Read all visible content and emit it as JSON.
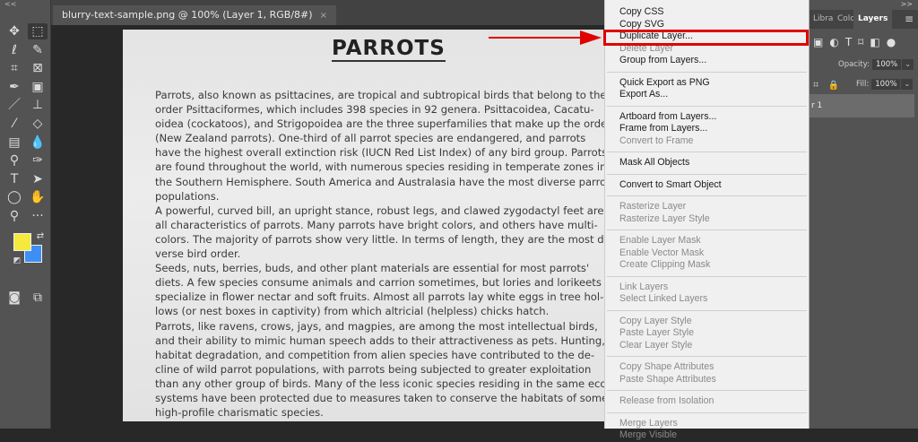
{
  "document_tab": {
    "title": "blurry-text-sample.png @ 100% (Layer 1, RGB/8#)",
    "close": "×"
  },
  "toolbar": {
    "collapse": "<<",
    "tools": [
      {
        "name": "move-tool",
        "glyph": "✥"
      },
      {
        "name": "marquee-tool",
        "glyph": "⬚"
      },
      {
        "name": "lasso-tool",
        "glyph": "ℓ"
      },
      {
        "name": "quick-selection-tool",
        "glyph": "✎"
      },
      {
        "name": "crop-tool",
        "glyph": "⌗"
      },
      {
        "name": "frame-tool",
        "glyph": "⊠"
      },
      {
        "name": "eyedropper-tool",
        "glyph": "✒"
      },
      {
        "name": "healing-tool",
        "glyph": "▣"
      },
      {
        "name": "brush-tool",
        "glyph": "／"
      },
      {
        "name": "stamp-tool",
        "glyph": "⊥"
      },
      {
        "name": "history-brush-tool",
        "glyph": "⁄"
      },
      {
        "name": "eraser-tool",
        "glyph": "◇"
      },
      {
        "name": "gradient-tool",
        "glyph": "▤"
      },
      {
        "name": "blur-tool",
        "glyph": "💧"
      },
      {
        "name": "dodge-tool",
        "glyph": "⚲"
      },
      {
        "name": "pen-tool",
        "glyph": "✑"
      },
      {
        "name": "type-tool",
        "glyph": "T"
      },
      {
        "name": "path-selection-tool",
        "glyph": "➤"
      },
      {
        "name": "ellipse-tool",
        "glyph": "◯"
      },
      {
        "name": "hand-tool",
        "glyph": "✋"
      },
      {
        "name": "zoom-tool",
        "glyph": "⚲"
      },
      {
        "name": "more-tools",
        "glyph": "···"
      },
      {
        "name": "quick-mask",
        "glyph": "◙"
      },
      {
        "name": "screen-mode",
        "glyph": "⧉"
      }
    ],
    "foreground_color": "#f5e93d",
    "background_color": "#3f8ef5"
  },
  "document": {
    "heading": "PARROTS",
    "lines": [
      "Parrots, also known as psittacines, are tropical and subtropical birds that belong to the",
      "order Psittaciformes, which includes 398 species in 92 genera. Psittacoidea, Cacatu-",
      "oidea (cockatoos), and Strigopoidea are the three superfamilies that make up the order",
      "(New Zealand parrots). One-third of all parrot species are endangered, and parrots",
      "have the highest overall extinction risk (IUCN Red List Index) of any bird group. Parrots",
      "are found throughout the world, with numerous species residing in temperate zones in",
      "the Southern Hemisphere. South America and Australasia have the most diverse parrot",
      "populations.",
      "A powerful, curved bill, an upright stance, robust legs, and clawed zygodactyl feet are",
      "all characteristics of parrots. Many parrots have bright colors, and others have multi-",
      "colors. The majority of parrots show very little. In terms of length, they are the most di-",
      "verse bird order.",
      "Seeds, nuts, berries, buds, and other plant materials are essential for most parrots'",
      "diets. A few species consume animals and carrion sometimes, but lories and lorikeets",
      "specialize in flower nectar and soft fruits. Almost all parrots lay white eggs in tree hol-",
      "lows (or nest boxes in captivity) from which altricial (helpless) chicks hatch.",
      "Parrots, like ravens, crows, jays, and magpies, are among the most intellectual birds,",
      "and their ability to mimic human speech adds to their attractiveness as pets. Hunting,",
      "habitat degradation, and competition from alien species have contributed to the de-",
      "cline of wild parrot populations, with parrots being subjected to greater exploitation",
      "than any other group of birds. Many of the less iconic species residing in the same eco-",
      "systems have been protected due to measures taken to conserve the habitats of some",
      "high-profile charismatic species."
    ]
  },
  "context_menu": {
    "groups": [
      [
        {
          "label": "Copy CSS",
          "enabled": true
        },
        {
          "label": "Copy SVG",
          "enabled": true
        },
        {
          "label": "Duplicate Layer...",
          "enabled": true,
          "highlighted": true
        },
        {
          "label": "Delete Layer",
          "enabled": false
        },
        {
          "label": "Group from Layers...",
          "enabled": true
        }
      ],
      [
        {
          "label": "Quick Export as PNG",
          "enabled": true
        },
        {
          "label": "Export As...",
          "enabled": true
        }
      ],
      [
        {
          "label": "Artboard from Layers...",
          "enabled": true
        },
        {
          "label": "Frame from Layers...",
          "enabled": true
        },
        {
          "label": "Convert to Frame",
          "enabled": false
        }
      ],
      [
        {
          "label": "Mask All Objects",
          "enabled": true
        }
      ],
      [
        {
          "label": "Convert to Smart Object",
          "enabled": true
        }
      ],
      [
        {
          "label": "Rasterize Layer",
          "enabled": false
        },
        {
          "label": "Rasterize Layer Style",
          "enabled": false
        }
      ],
      [
        {
          "label": "Enable Layer Mask",
          "enabled": false
        },
        {
          "label": "Enable Vector Mask",
          "enabled": false
        },
        {
          "label": "Create Clipping Mask",
          "enabled": false
        }
      ],
      [
        {
          "label": "Link Layers",
          "enabled": false
        },
        {
          "label": "Select Linked Layers",
          "enabled": false
        }
      ],
      [
        {
          "label": "Copy Layer Style",
          "enabled": false
        },
        {
          "label": "Paste Layer Style",
          "enabled": false
        },
        {
          "label": "Clear Layer Style",
          "enabled": false
        }
      ],
      [
        {
          "label": "Copy Shape Attributes",
          "enabled": false
        },
        {
          "label": "Paste Shape Attributes",
          "enabled": false
        }
      ],
      [
        {
          "label": "Release from Isolation",
          "enabled": false
        }
      ],
      [
        {
          "label": "Merge Layers",
          "enabled": false
        },
        {
          "label": "Merge Visible",
          "enabled": false
        }
      ]
    ]
  },
  "annotation": {
    "highlight_color": "#e10000"
  },
  "panel": {
    "collapse": ">>",
    "tabs": [
      "Libra",
      "Colo",
      "Layers"
    ],
    "menu": "≡",
    "opacity_label": "Opacity:",
    "opacity_value": "100%",
    "fill_label": "Fill:",
    "fill_value": "100%",
    "dropdown": "⌄",
    "layer_name": "r 1"
  }
}
